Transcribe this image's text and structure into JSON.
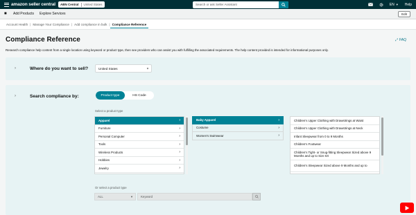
{
  "topbar": {
    "logo": "amazon seller central",
    "account": "ABN Central",
    "marketplace": "United States",
    "search_placeholder": "Search or ask Seller Assistant",
    "language": "EN",
    "help": "Help"
  },
  "subnav": {
    "links": [
      "Add Products",
      "Explore Services"
    ],
    "edit": "Edit"
  },
  "breadcrumbs": [
    "Account Health",
    "Manage Your Compliance",
    "Add compliance in bulk",
    "Compliance Reference"
  ],
  "page": {
    "title": "Compliance Reference",
    "faq": "FAQ",
    "description": "Research compliance help content from a single location using keyword or product type, then see providers who can assist you with fulfilling the associated requirements. The help content provided is intended for informational purposes only."
  },
  "sell_panel": {
    "label": "Where do you want to sell?",
    "selected": "United States"
  },
  "search_panel": {
    "label": "Search compliance by:",
    "toggle": [
      "Product type",
      "HS Code"
    ],
    "select_label": "Select a product type",
    "col1": [
      "Apparel",
      "Furniture",
      "Personal Computer",
      "Tools",
      "Wireless Products",
      "Hobbies",
      "Jewelry"
    ],
    "col2": [
      "Baby Apparel",
      "Costume",
      "Women's Swimwear"
    ],
    "col3": [
      "Children's Upper Clothing with Drawstrings at Waist",
      "Children's Upper Clothing with Drawstrings at Neck",
      "Infant Sleepwear from 0 to 9 Months",
      "Children's Footwear",
      "Children's Tight- or Snug-fitting Sleepwear Sized above 9 Months and up to Size 6X",
      "Children's Sleepwear Sized above 9 Months and up to"
    ],
    "or_label": "Or select a product type",
    "filter_value": "ALL",
    "keyword_placeholder": "Keyword"
  },
  "colors": {
    "nav": "#002f36",
    "accent": "#008296",
    "panel": "#e7f3f4"
  }
}
